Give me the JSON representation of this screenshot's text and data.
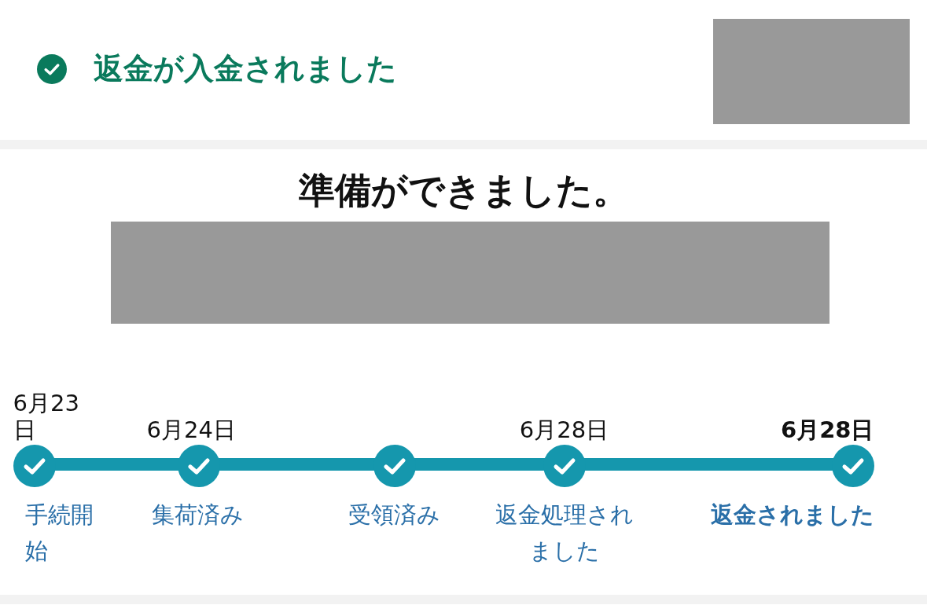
{
  "status": {
    "title": "返金が入金されました",
    "done": true
  },
  "heading": "準備ができました。",
  "timeline": {
    "steps": [
      {
        "date": "6月23日",
        "label": "手続開始",
        "done": true,
        "selected": false
      },
      {
        "date": "6月24日",
        "label": "集荷済み",
        "done": true,
        "selected": false
      },
      {
        "label": "受領済み",
        "done": true,
        "selected": false
      },
      {
        "date": "6月28日",
        "label": "返金処理されました",
        "done": true,
        "selected": false
      },
      {
        "date": "6月28日",
        "label": "返金されました",
        "done": true,
        "selected": true
      }
    ]
  }
}
